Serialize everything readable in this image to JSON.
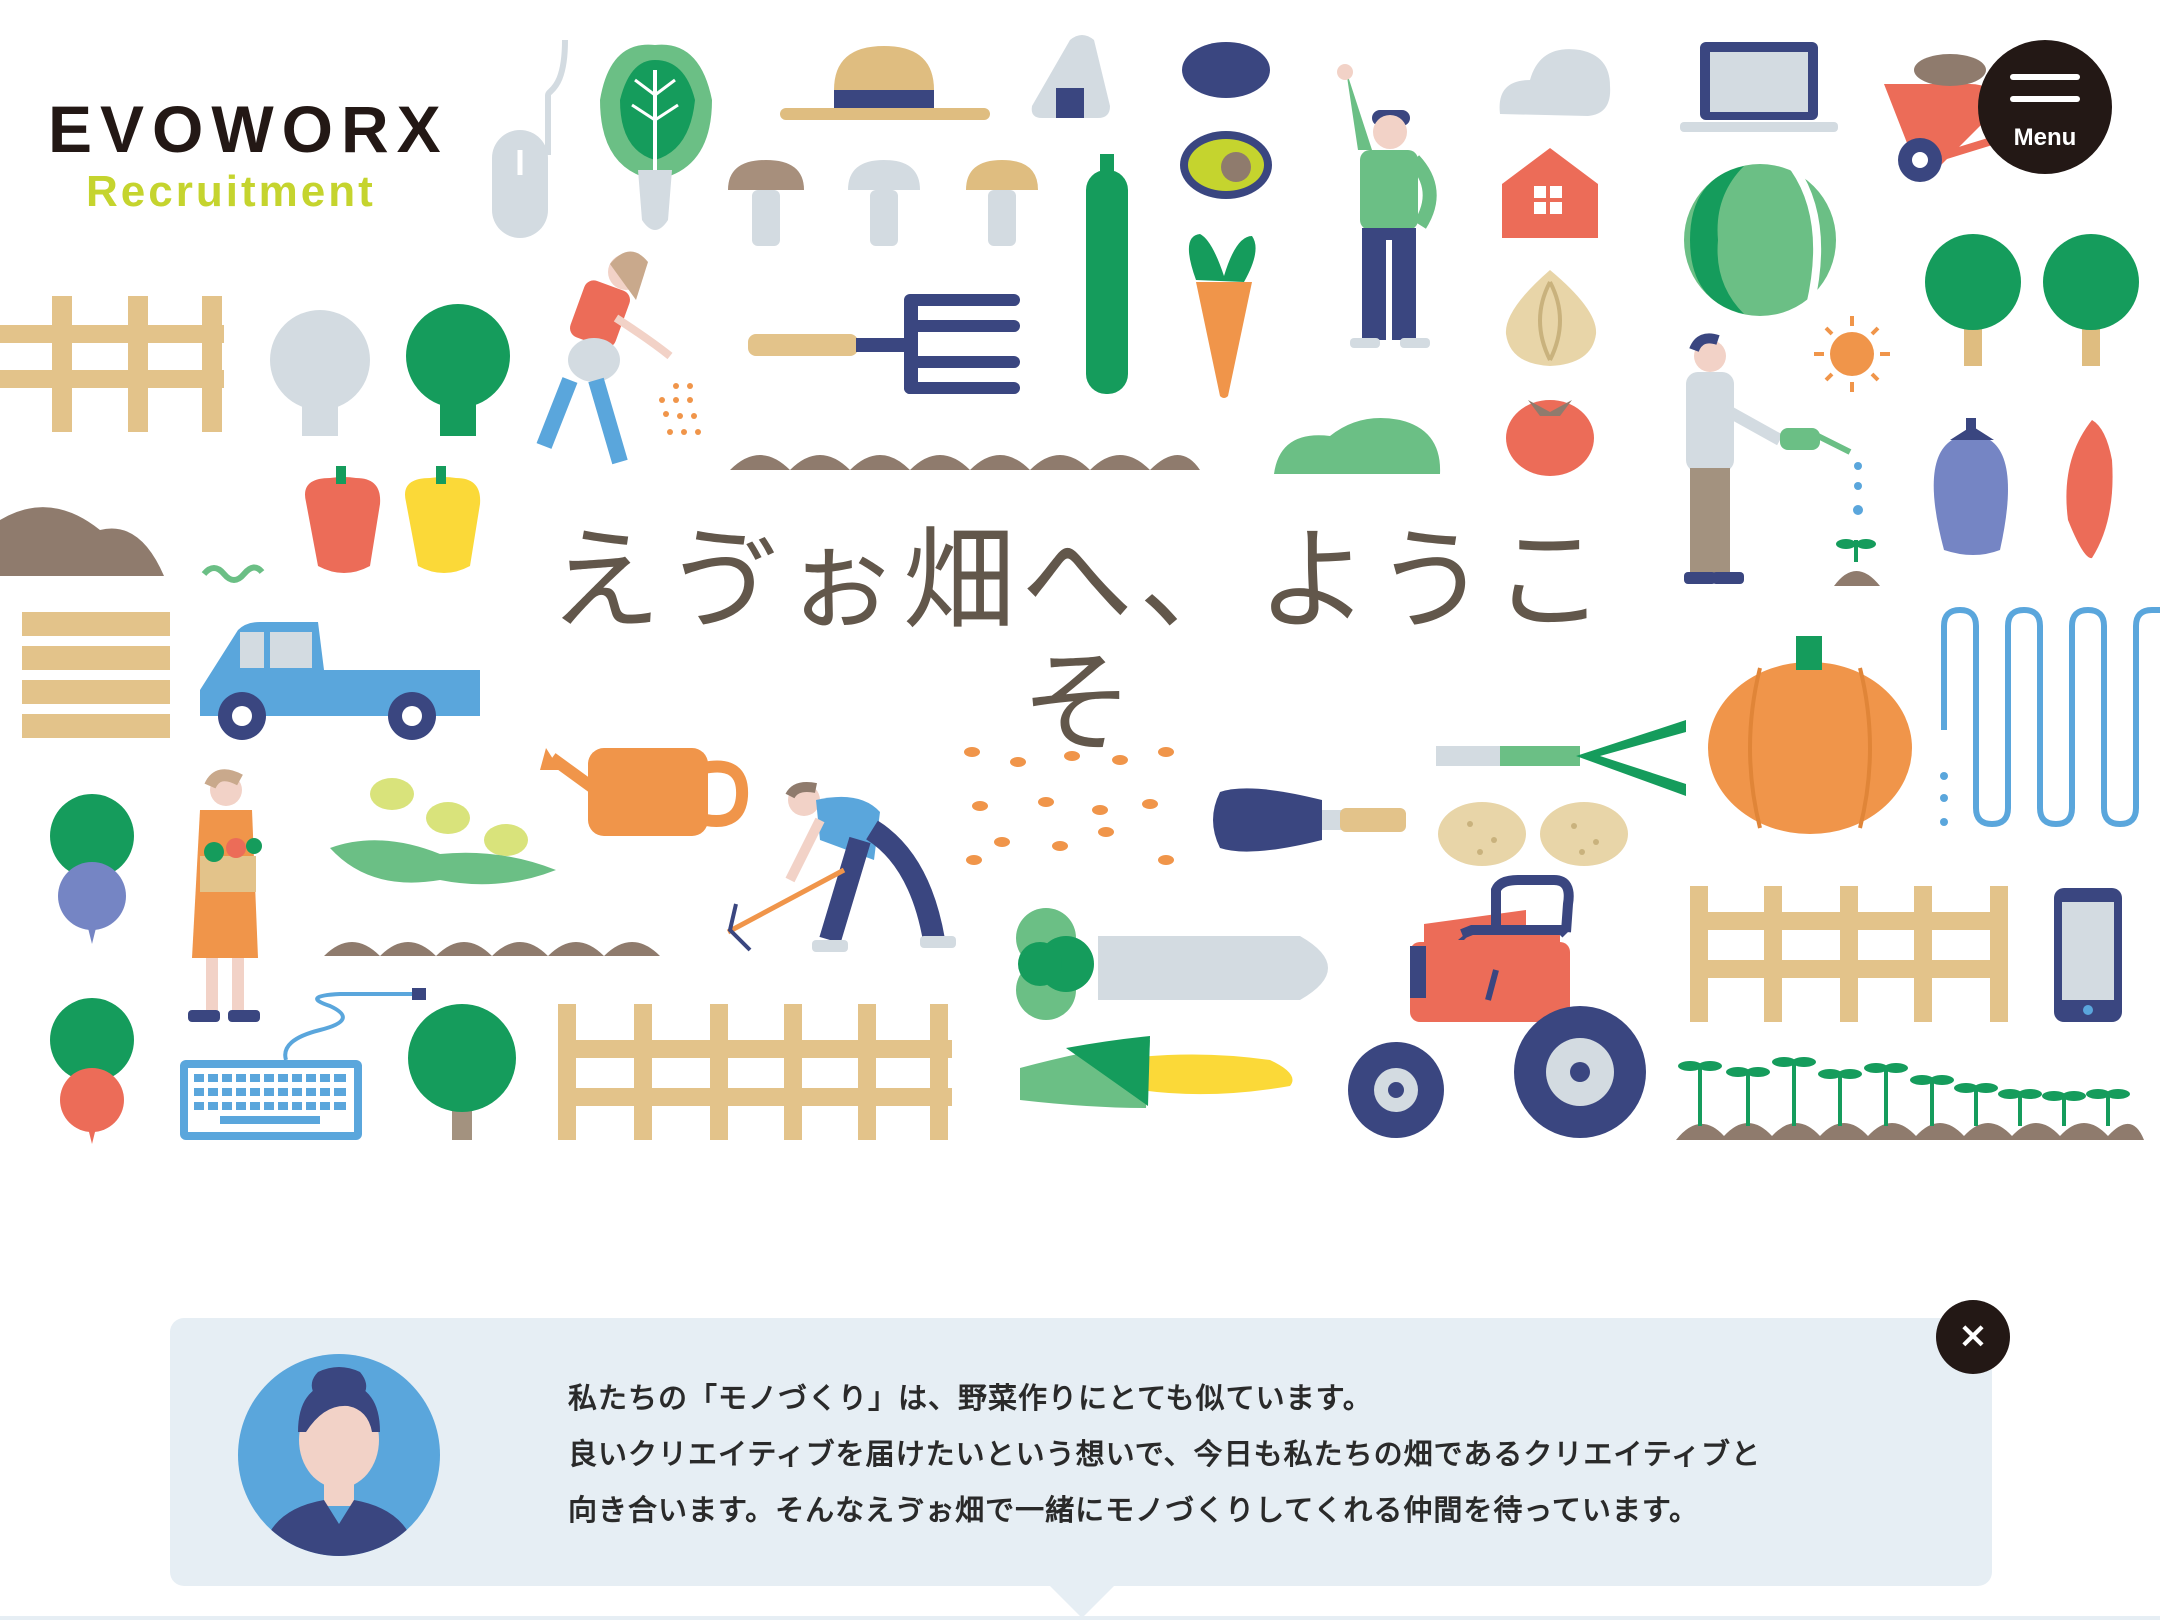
{
  "brand": {
    "name": "EVOWORX",
    "sub": "Recruitment"
  },
  "menu": {
    "label": "Menu",
    "icon": "hamburger-icon"
  },
  "hero": {
    "welcome": "えゔぉ畑へ、ようこそ"
  },
  "message": {
    "lines": [
      "私たちの「モノづくり」は、野菜作りにとても似ています。",
      "良いクリエイティブを届けたいという想いで、今日も私たちの畑であるクリエイティブと",
      "向き合います。そんなえゔぉ畑で一緒にモノづくりしてくれる仲間を待っています。"
    ]
  },
  "close": {
    "glyph": "×",
    "icon": "close-icon"
  },
  "colors": {
    "green": "#159c5c",
    "light_green": "#6bbf85",
    "orange": "#f0954a",
    "red": "#ec6c58",
    "navy": "#3a4680",
    "wood": "#e3c38a",
    "brown": "#8f7b6d",
    "sky": "#5aa6dc",
    "yellow": "#fbd938",
    "gray": "#d3dbe1",
    "logo_accent": "#c5d42e",
    "dark": "#231815",
    "panel": "#e6eef4"
  }
}
